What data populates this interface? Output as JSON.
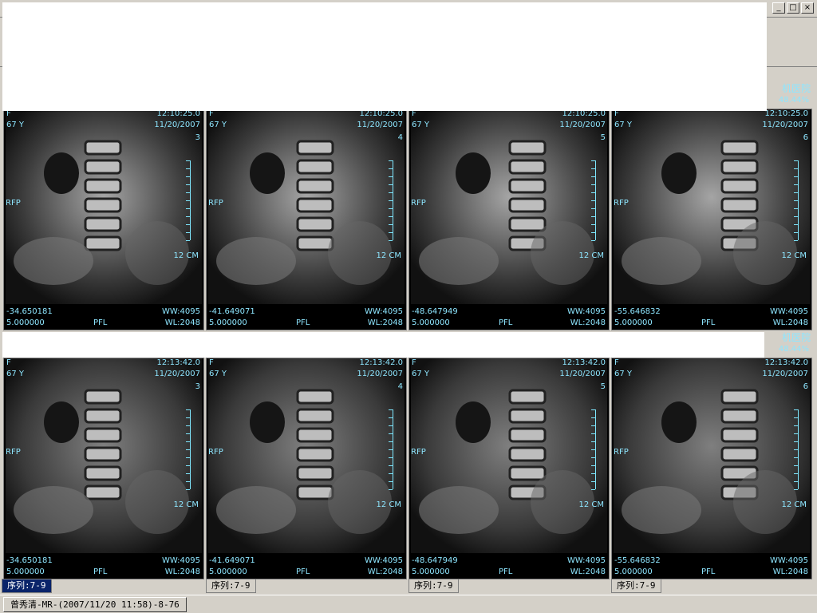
{
  "window": {
    "min_label": "_",
    "max_label": "□",
    "close_label": "×"
  },
  "status": {
    "study": "曾秀清-MR-(2007/11/20 11:58)-8-76"
  },
  "tabs": [
    {
      "label": "序列:7-9",
      "active": true
    },
    {
      "label": "序列:7-9",
      "active": false
    },
    {
      "label": "序列:7-9",
      "active": false
    },
    {
      "label": "序列:7-9",
      "active": false
    }
  ],
  "hospital": "机医院",
  "hospital_prefix": "矿轮",
  "rows": [
    {
      "time": "12:10:25.0",
      "zoom": "48.44%",
      "cells": [
        {
          "sex": "F",
          "age": "67 Y",
          "date": "11/20/2007",
          "num": "3",
          "side": "RFP",
          "scale": "12 CM",
          "pos": "-34.650181",
          "thick": "5.000000",
          "orient": "PFL",
          "ww": "WW:4095",
          "wl": "WL:2048"
        },
        {
          "sex": "F",
          "age": "67 Y",
          "date": "11/20/2007",
          "num": "4",
          "side": "RFP",
          "scale": "12 CM",
          "pos": "-41.649071",
          "thick": "5.000000",
          "orient": "PFL",
          "ww": "WW:4095",
          "wl": "WL:2048"
        },
        {
          "sex": "F",
          "age": "67 Y",
          "date": "11/20/2007",
          "num": "5",
          "side": "RFP",
          "scale": "12 CM",
          "pos": "-48.647949",
          "thick": "5.000000",
          "orient": "PFL",
          "ww": "WW:4095",
          "wl": "WL:2048"
        },
        {
          "sex": "F",
          "age": "67 Y",
          "date": "11/20/2007",
          "num": "6",
          "side": "RFP",
          "scale": "12 CM",
          "pos": "-55.646832",
          "thick": "5.000000",
          "orient": "PFL",
          "ww": "WW:4095",
          "wl": "WL:2048"
        }
      ]
    },
    {
      "time": "12:13:42.0",
      "zoom": "48.44%",
      "cells": [
        {
          "sex": "F",
          "age": "67 Y",
          "date": "11/20/2007",
          "num": "3",
          "side": "RFP",
          "scale": "12 CM",
          "pos": "-34.650181",
          "thick": "5.000000",
          "orient": "PFL",
          "ww": "WW:4095",
          "wl": "WL:2048"
        },
        {
          "sex": "F",
          "age": "67 Y",
          "date": "11/20/2007",
          "num": "4",
          "side": "RFP",
          "scale": "12 CM",
          "pos": "-41.649071",
          "thick": "5.000000",
          "orient": "PFL",
          "ww": "WW:4095",
          "wl": "WL:2048"
        },
        {
          "sex": "F",
          "age": "67 Y",
          "date": "11/20/2007",
          "num": "5",
          "side": "RFP",
          "scale": "12 CM",
          "pos": "-48.647949",
          "thick": "5.000000",
          "orient": "PFL",
          "ww": "WW:4095",
          "wl": "WL:2048"
        },
        {
          "sex": "F",
          "age": "67 Y",
          "date": "11/20/2007",
          "num": "6",
          "side": "RFP",
          "scale": "12 CM",
          "pos": "-55.646832",
          "thick": "5.000000",
          "orient": "PFL",
          "ww": "WW:4095",
          "wl": "WL:2048"
        }
      ]
    }
  ],
  "colors": {
    "overlay_text": "#8ee6ff",
    "background": "#d4d0c8",
    "tab_active": "#0a246a"
  }
}
